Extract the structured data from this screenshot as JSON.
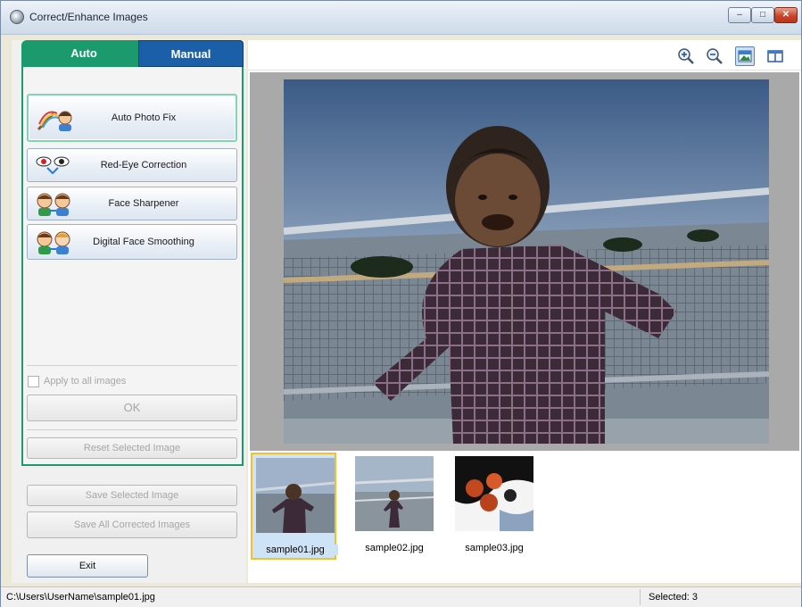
{
  "window": {
    "title": "Correct/Enhance Images",
    "minimize": "–",
    "maximize": "□",
    "close": "✕"
  },
  "tabs": {
    "auto": "Auto",
    "manual": "Manual"
  },
  "functions": [
    {
      "label": "Auto Photo Fix",
      "icon": "auto-photo-fix-icon"
    },
    {
      "label": "Red-Eye Correction",
      "icon": "red-eye-icon"
    },
    {
      "label": "Face Sharpener",
      "icon": "face-sharpener-icon"
    },
    {
      "label": "Digital Face Smoothing",
      "icon": "face-smoothing-icon"
    }
  ],
  "apply_all_label": "Apply to all images",
  "ok_label": "OK",
  "reset_label": "Reset Selected Image",
  "save_selected_label": "Save Selected Image",
  "save_all_label": "Save All Corrected Images",
  "exit_label": "Exit",
  "toolbar": {
    "zoom_in": "zoom-in-icon",
    "zoom_out": "zoom-out-icon",
    "whole_image": "whole-image-icon",
    "compare": "compare-icon"
  },
  "thumbnails": [
    {
      "name": "sample01.jpg",
      "selected": true
    },
    {
      "name": "sample02.jpg",
      "selected": false
    },
    {
      "name": "sample03.jpg",
      "selected": false
    }
  ],
  "status": {
    "path": "C:\\Users\\UserName\\sample01.jpg",
    "selected": "Selected: 3"
  },
  "colors": {
    "auto_tab": "#1b9a6e",
    "manual_tab": "#1c5fa9",
    "selection": "#f2c228"
  }
}
